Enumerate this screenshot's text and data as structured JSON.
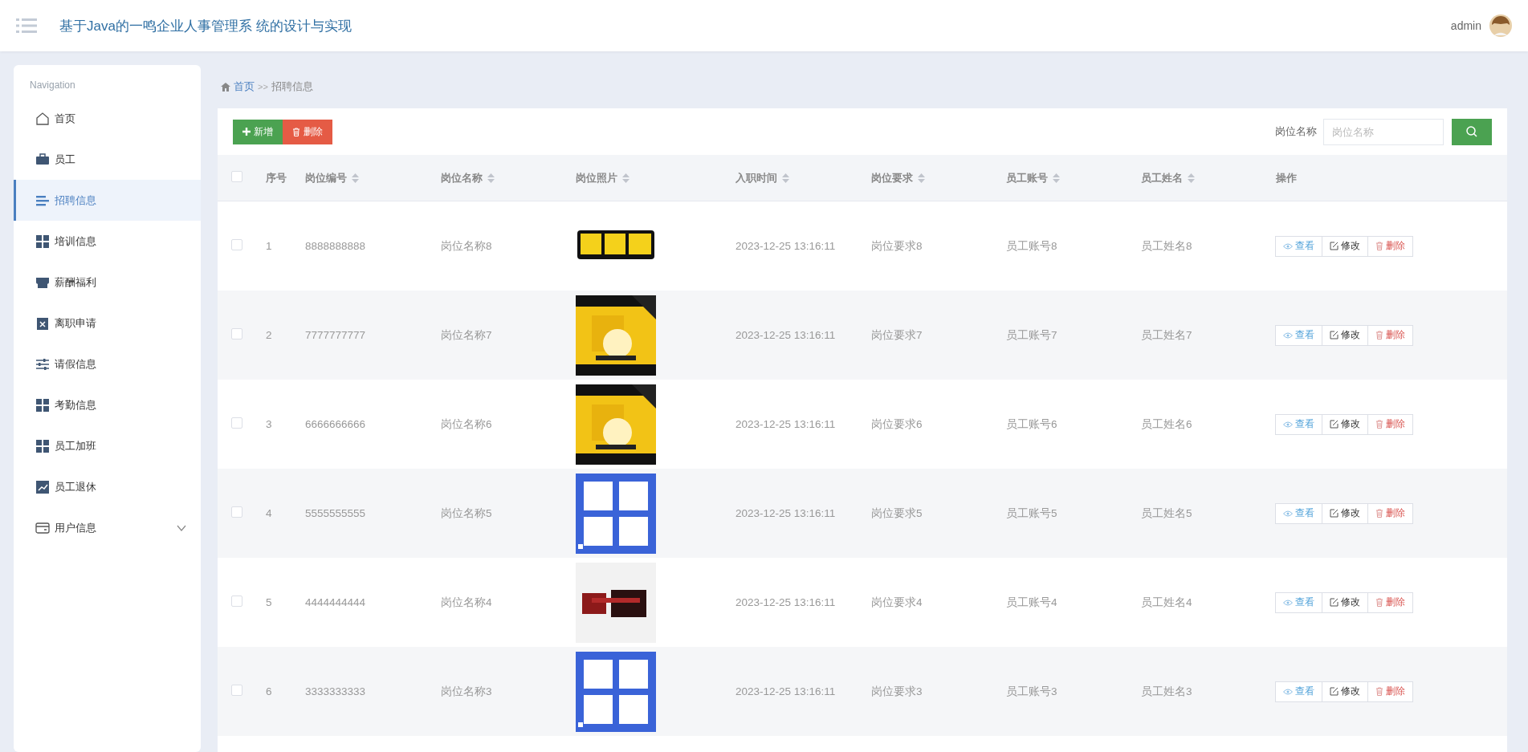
{
  "header": {
    "title": "基于Java的一鸣企业人事管理系 统的设计与实现",
    "user": "admin"
  },
  "sidebar": {
    "heading": "Navigation",
    "items": [
      {
        "label": "首页",
        "selected": false
      },
      {
        "label": "员工",
        "selected": false
      },
      {
        "label": "招聘信息",
        "selected": true
      },
      {
        "label": "培训信息",
        "selected": false
      },
      {
        "label": "薪酬福利",
        "selected": false
      },
      {
        "label": "离职申请",
        "selected": false
      },
      {
        "label": "请假信息",
        "selected": false
      },
      {
        "label": "考勤信息",
        "selected": false
      },
      {
        "label": "员工加班",
        "selected": false
      },
      {
        "label": "员工退休",
        "selected": false
      },
      {
        "label": "用户信息",
        "selected": false,
        "expanded": false
      }
    ]
  },
  "breadcrumb": [
    "首页",
    ">>",
    "招聘信息"
  ],
  "toolbar": {
    "add": "新增",
    "delete": "删除",
    "search_label": "岗位名称",
    "search": {
      "placeholder": "岗位名称"
    }
  },
  "table": {
    "select_all": {
      "checked": false
    },
    "columns": [
      {
        "label": "序号",
        "sortable": false
      },
      {
        "label": "岗位编号",
        "sortable": true
      },
      {
        "label": "岗位名称",
        "sortable": true
      },
      {
        "label": "岗位照片",
        "sortable": true
      },
      {
        "label": "入职时间",
        "sortable": true
      },
      {
        "label": "岗位要求",
        "sortable": true
      },
      {
        "label": "员工账号",
        "sortable": true
      },
      {
        "label": "员工姓名",
        "sortable": true
      },
      {
        "label": "操作",
        "sortable": false
      }
    ],
    "rows": [
      {
        "checked": false,
        "index": "1",
        "code": "8888888888",
        "name": "岗位名称8",
        "time": "2023-12-25 13:16:11",
        "requirement": "岗位要求8",
        "account": "员工账号8",
        "employee": "员工姓名8",
        "actions": [
          "查看",
          "修改",
          "删除"
        ]
      },
      {
        "checked": false,
        "index": "2",
        "code": "7777777777",
        "name": "岗位名称7",
        "time": "2023-12-25 13:16:11",
        "requirement": "岗位要求7",
        "account": "员工账号7",
        "employee": "员工姓名7",
        "actions": [
          "查看",
          "修改",
          "删除"
        ]
      },
      {
        "checked": false,
        "index": "3",
        "code": "6666666666",
        "name": "岗位名称6",
        "time": "2023-12-25 13:16:11",
        "requirement": "岗位要求6",
        "account": "员工账号6",
        "employee": "员工姓名6",
        "actions": [
          "查看",
          "修改",
          "删除"
        ]
      },
      {
        "checked": false,
        "index": "4",
        "code": "5555555555",
        "name": "岗位名称5",
        "time": "2023-12-25 13:16:11",
        "requirement": "岗位要求5",
        "account": "员工账号5",
        "employee": "员工姓名5",
        "actions": [
          "查看",
          "修改",
          "删除"
        ]
      },
      {
        "checked": false,
        "index": "5",
        "code": "4444444444",
        "name": "岗位名称4",
        "time": "2023-12-25 13:16:11",
        "requirement": "岗位要求4",
        "account": "员工账号4",
        "employee": "员工姓名4",
        "actions": [
          "查看",
          "修改",
          "删除"
        ]
      },
      {
        "checked": false,
        "index": "6",
        "code": "3333333333",
        "name": "岗位名称3",
        "time": "2023-12-25 13:16:11",
        "requirement": "岗位要求3",
        "account": "员工账号3",
        "employee": "员工姓名3",
        "actions": [
          "查看",
          "修改",
          "删除"
        ]
      }
    ]
  }
}
